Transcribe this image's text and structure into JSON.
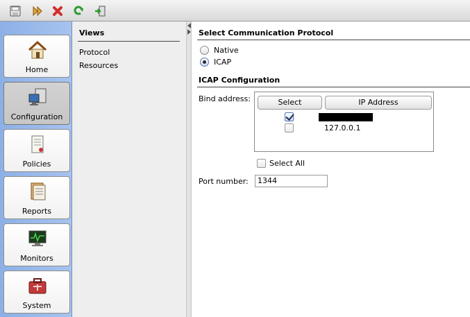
{
  "toolbar": {
    "icons": [
      "save-icon",
      "forward-icon",
      "delete-icon",
      "refresh-icon",
      "exit-icon"
    ]
  },
  "nav": {
    "items": [
      {
        "label": "Home",
        "icon": "home-icon"
      },
      {
        "label": "Configuration",
        "icon": "configuration-icon",
        "selected": true
      },
      {
        "label": "Policies",
        "icon": "policies-icon"
      },
      {
        "label": "Reports",
        "icon": "reports-icon"
      },
      {
        "label": "Monitors",
        "icon": "monitors-icon"
      },
      {
        "label": "System",
        "icon": "system-icon"
      }
    ]
  },
  "views": {
    "title": "Views",
    "links": [
      "Protocol",
      "Resources"
    ]
  },
  "main": {
    "protocol": {
      "title": "Select Communication Protocol",
      "options": [
        {
          "label": "Native",
          "selected": false
        },
        {
          "label": "ICAP",
          "selected": true
        }
      ]
    },
    "icap": {
      "title": "ICAP Configuration",
      "bind_label": "Bind address:",
      "table": {
        "headers": [
          "Select",
          "IP Address"
        ],
        "rows": [
          {
            "checked": true,
            "ip": "",
            "redacted": true
          },
          {
            "checked": false,
            "ip": "127.0.0.1",
            "redacted": false
          }
        ]
      },
      "select_all_label": "Select All",
      "select_all_checked": false,
      "port_label": "Port number:",
      "port_value": "1344"
    }
  },
  "colors": {
    "nav_bg": "#8cb0e6",
    "views_bg": "#eeeeee",
    "delete_red": "#d62b2b",
    "refresh_green": "#2f9a34"
  }
}
